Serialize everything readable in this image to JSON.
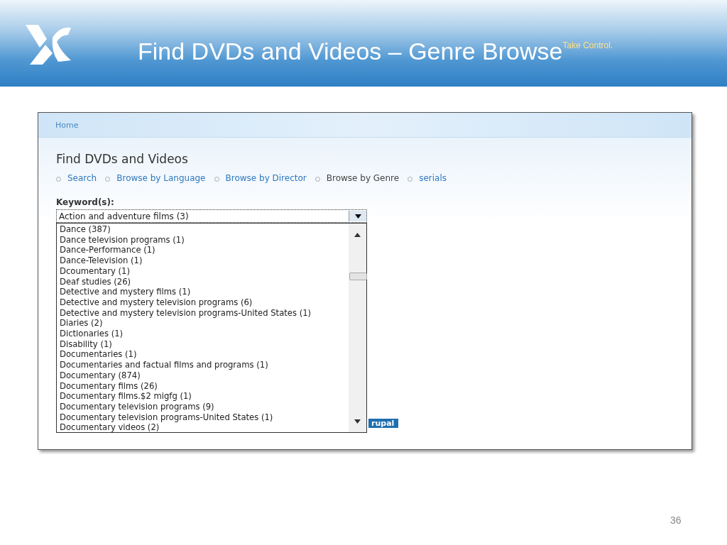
{
  "slide": {
    "title": "Find DVDs and Videos – Genre Browse",
    "tagline": "Take Control.",
    "page_number": "36"
  },
  "breadcrumb": [
    "Home"
  ],
  "page": {
    "heading": "Find DVDs and Videos",
    "nav": [
      {
        "label": "Search",
        "selected": false
      },
      {
        "label": "Browse by Language",
        "selected": false
      },
      {
        "label": "Browse by Director",
        "selected": false
      },
      {
        "label": "Browse by Genre",
        "selected": true
      },
      {
        "label": "serials",
        "selected": false
      }
    ],
    "keyword_label": "Keyword(s):",
    "select_value": "Action and adventure films (3)",
    "options": [
      "Dance (387)",
      "Dance television programs (1)",
      "Dance-Performance (1)",
      "Dance-Television (1)",
      "Dcoumentary (1)",
      "Deaf studies (26)",
      "Detective and mystery films (1)",
      "Detective and mystery television programs (6)",
      "Detective and mystery television programs-United States (1)",
      "Diaries (2)",
      "Dictionaries (1)",
      "Disability (1)",
      "Documentaries (1)",
      "Documentaries and factual films and programs (1)",
      "Documentary (874)",
      "Documentary films (26)",
      "Documentary films.$2 migfg (1)",
      "Documentary television programs (9)",
      "Documentary television programs-United States (1)",
      "Documentary videos (2)"
    ],
    "footer_badge": "rupal"
  }
}
